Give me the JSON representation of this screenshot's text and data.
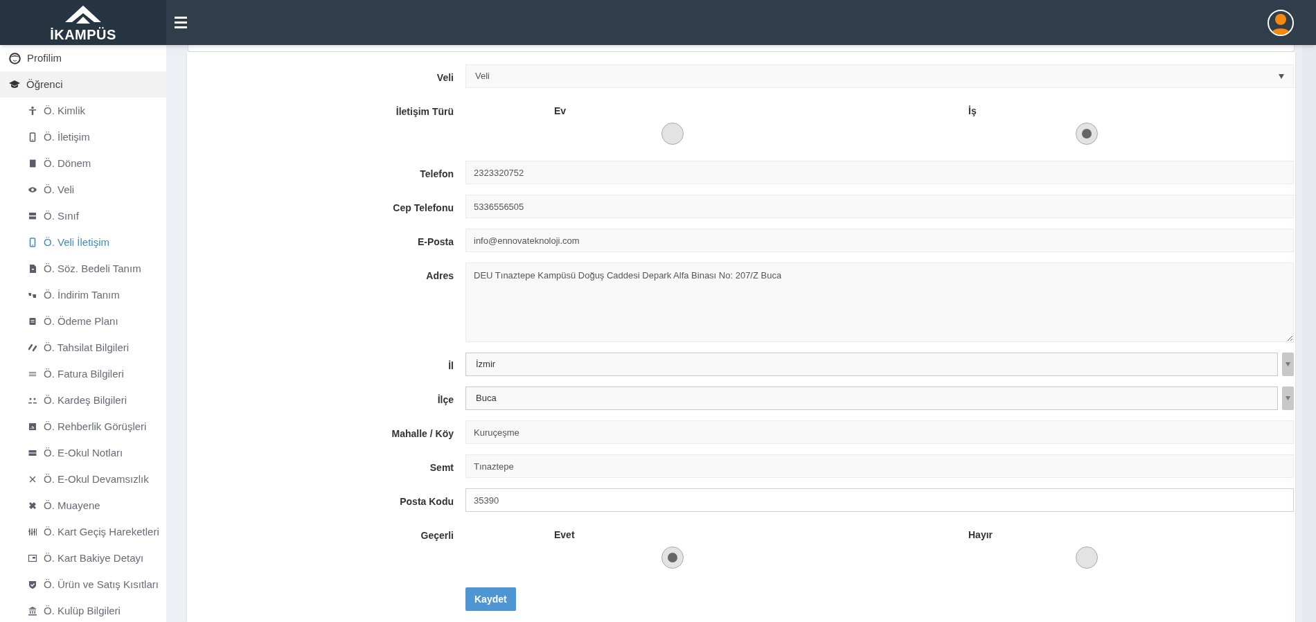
{
  "header": {
    "logo_text": "İKAMPÜS"
  },
  "sidebar": {
    "items": [
      {
        "label": "Profilim",
        "selected": false
      },
      {
        "label": "Öğrenci",
        "selected": false,
        "expanded": true,
        "children": [
          {
            "label": "Ö. Kimlik",
            "selected": false
          },
          {
            "label": "Ö. İletişim",
            "selected": false
          },
          {
            "label": "Ö. Dönem",
            "selected": false
          },
          {
            "label": "Ö. Veli",
            "selected": false
          },
          {
            "label": "Ö. Sınıf",
            "selected": false
          },
          {
            "label": "Ö. Veli İletişim",
            "selected": true
          },
          {
            "label": "Ö. Söz. Bedeli Tanım",
            "selected": false
          },
          {
            "label": "Ö. İndirim Tanım",
            "selected": false
          },
          {
            "label": "Ö. Ödeme Planı",
            "selected": false
          },
          {
            "label": "Ö. Tahsilat Bilgileri",
            "selected": false
          },
          {
            "label": "Ö. Fatura Bilgileri",
            "selected": false
          },
          {
            "label": "Ö. Kardeş Bilgileri",
            "selected": false
          },
          {
            "label": "Ö. Rehberlik Görüşleri",
            "selected": false
          },
          {
            "label": "Ö. E-Okul Notları",
            "selected": false
          },
          {
            "label": "Ö. E-Okul Devamsızlık",
            "selected": false
          },
          {
            "label": "Ö. Muayene",
            "selected": false
          },
          {
            "label": "Ö. Kart Geçiş Hareketleri",
            "selected": false
          },
          {
            "label": "Ö. Kart Bakiye Detayı",
            "selected": false
          },
          {
            "label": "Ö. Ürün ve Satış Kısıtları",
            "selected": false
          },
          {
            "label": "Ö. Kulüp Bilgileri",
            "selected": false
          }
        ]
      }
    ]
  },
  "form": {
    "fields": [
      {
        "kind": "select",
        "label": "Veli",
        "value": "Veli"
      },
      {
        "kind": "radio",
        "label": "İletişim Türü",
        "options": [
          {
            "label": "Ev",
            "selected": false
          },
          {
            "label": "İş",
            "selected": true
          }
        ]
      },
      {
        "kind": "text",
        "label": "Telefon",
        "value": "2323320752",
        "focused": false
      },
      {
        "kind": "text",
        "label": "Cep Telefonu",
        "value": "5336556505",
        "focused": false
      },
      {
        "kind": "text",
        "label": "E-Posta",
        "value": "info@ennovateknoloji.com",
        "focused": false
      },
      {
        "kind": "textarea",
        "label": "Adres",
        "value": "DEU Tınaztepe Kampüsü Doğuş Caddesi Depark Alfa Binası No: 207/Z Buca"
      },
      {
        "kind": "combo",
        "label": "İl",
        "value": "İzmir"
      },
      {
        "kind": "combo",
        "label": "İlçe",
        "value": "Buca"
      },
      {
        "kind": "text",
        "label": "Mahalle / Köy",
        "value": "Kuruçeşme",
        "focused": false
      },
      {
        "kind": "text",
        "label": "Semt",
        "value": "Tınaztepe",
        "focused": false
      },
      {
        "kind": "text",
        "label": "Posta Kodu",
        "value": "35390",
        "focused": true
      },
      {
        "kind": "radio",
        "label": "Geçerli",
        "options": [
          {
            "label": "Evet",
            "selected": true
          },
          {
            "label": "Hayır",
            "selected": false
          }
        ]
      }
    ],
    "submit": "Kaydet"
  }
}
